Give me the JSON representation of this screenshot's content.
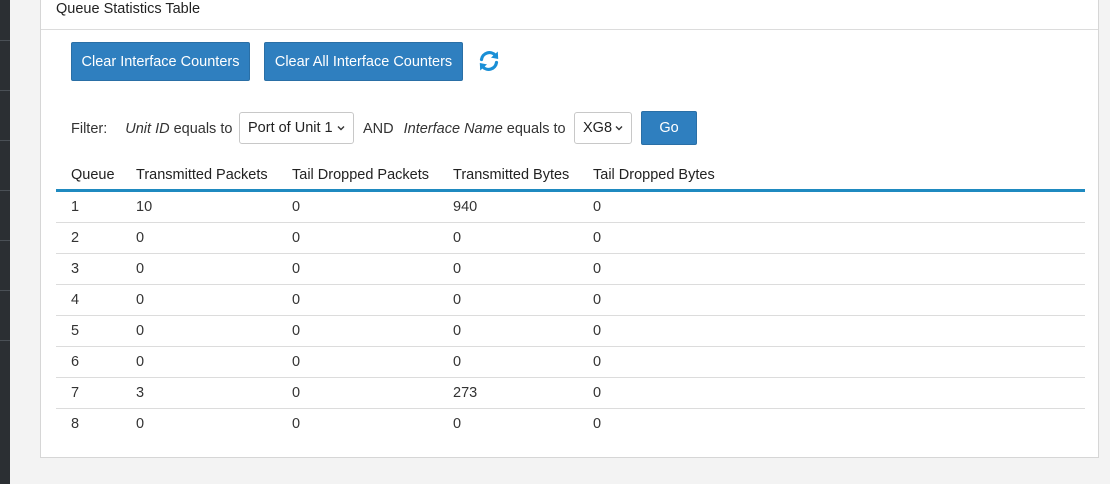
{
  "panel": {
    "title": "Queue Statistics Table"
  },
  "toolbar": {
    "clear_label": "Clear Interface Counters",
    "clear_all_label": "Clear All Interface Counters",
    "refresh_icon": "refresh-icon"
  },
  "filter": {
    "label": "Filter:",
    "unit_field": "Unit ID",
    "equals_to": "equals to",
    "unit_value": "Port of Unit 1",
    "and": "AND",
    "iface_field": "Interface Name",
    "equals_to_2": "equals to",
    "iface_value": "XG8",
    "go_label": "Go"
  },
  "table": {
    "headers": [
      "Queue",
      "Transmitted Packets",
      "Tail Dropped Packets",
      "Transmitted Bytes",
      "Tail Dropped Bytes"
    ],
    "rows": [
      [
        "1",
        "10",
        "0",
        "940",
        "0"
      ],
      [
        "2",
        "0",
        "0",
        "0",
        "0"
      ],
      [
        "3",
        "0",
        "0",
        "0",
        "0"
      ],
      [
        "4",
        "0",
        "0",
        "0",
        "0"
      ],
      [
        "5",
        "0",
        "0",
        "0",
        "0"
      ],
      [
        "6",
        "0",
        "0",
        "0",
        "0"
      ],
      [
        "7",
        "3",
        "0",
        "273",
        "0"
      ],
      [
        "8",
        "0",
        "0",
        "0",
        "0"
      ]
    ]
  },
  "colors": {
    "accent": "#2f7fbf",
    "header_rule": "#1f8ac0",
    "refresh_icon": "#1a8fd6"
  }
}
